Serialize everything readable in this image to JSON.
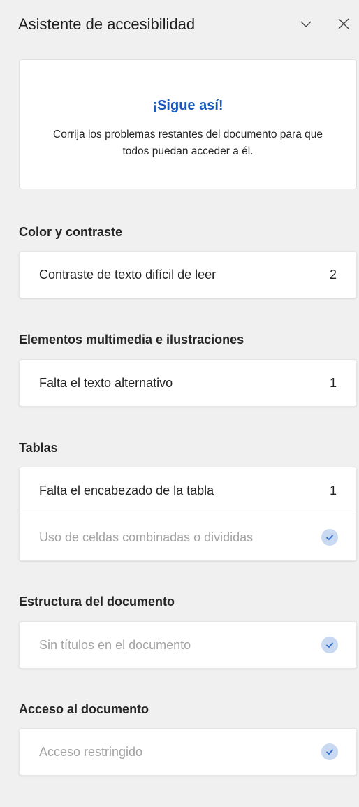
{
  "pane": {
    "title": "Asistente de accesibilidad",
    "collapse_icon": "chevron-down-icon",
    "close_icon": "close-icon"
  },
  "banner": {
    "title": "¡Sigue así!",
    "text": "Corrija los problemas restantes del documento para que todos puedan acceder a él.",
    "title_color": "#185abd"
  },
  "sections": [
    {
      "title": "Color y contraste",
      "items": [
        {
          "label": "Contraste de texto difícil de leer",
          "count": "2"
        }
      ]
    },
    {
      "title": "Elementos multimedia e ilustraciones",
      "items": [
        {
          "label": "Falta el texto alternativo",
          "count": "1"
        }
      ]
    },
    {
      "title": "Tablas",
      "items": [
        {
          "label": "Falta el encabezado de la tabla",
          "count": "1"
        },
        {
          "label": "Uso de celdas combinadas o divididas",
          "status": "check-icon"
        }
      ]
    },
    {
      "title": "Estructura del documento",
      "items": [
        {
          "label": "Sin títulos en el documento",
          "status": "check-icon"
        }
      ]
    },
    {
      "title": "Acceso al documento",
      "items": [
        {
          "label": "Acceso restringido",
          "status": "check-icon"
        }
      ]
    }
  ],
  "colors": {
    "accent": "#185abd",
    "check_bg": "#c9d9f2",
    "check_mark": "#2f6ccf",
    "resolved_text": "#a3a3a3"
  }
}
